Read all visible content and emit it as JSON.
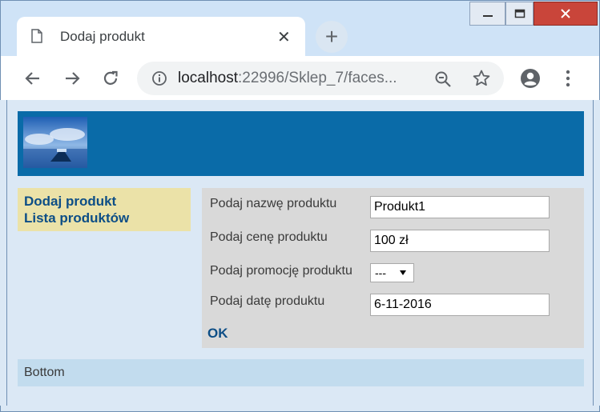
{
  "tab": {
    "title": "Dodaj produkt",
    "close_glyph": "✕"
  },
  "newtab_glyph": "+",
  "address": {
    "host": "localhost",
    "rest": ":22996/Sklep_7/faces..."
  },
  "icons": {
    "doc": "document-icon",
    "back": "back-arrow-icon",
    "forward": "forward-arrow-icon",
    "reload": "reload-icon",
    "info": "info-icon",
    "zoom": "zoom-out-icon",
    "star": "bookmark-star-icon",
    "profile": "profile-icon",
    "menu": "more-vert-icon"
  },
  "colors": {
    "header": "#0a6ba8",
    "menu_bg": "#ebe2a8",
    "link": "#0d4e86",
    "form_bg": "#d9d9d9",
    "footer_bg": "#c2dcee",
    "page_bg": "#dbe8f5"
  },
  "menu": {
    "items": [
      "Dodaj produkt",
      "Lista produktów"
    ]
  },
  "form": {
    "name_label": "Podaj nazwę produktu",
    "name_value": "Produkt1",
    "price_label": "Podaj cenę produktu",
    "price_value": "100 zł",
    "promo_label": "Podaj promocję produktu",
    "promo_selected": "---",
    "date_label": "Podaj datę produktu",
    "date_value": "6-11-2016",
    "submit_label": "OK"
  },
  "footer": {
    "text": "Bottom"
  }
}
